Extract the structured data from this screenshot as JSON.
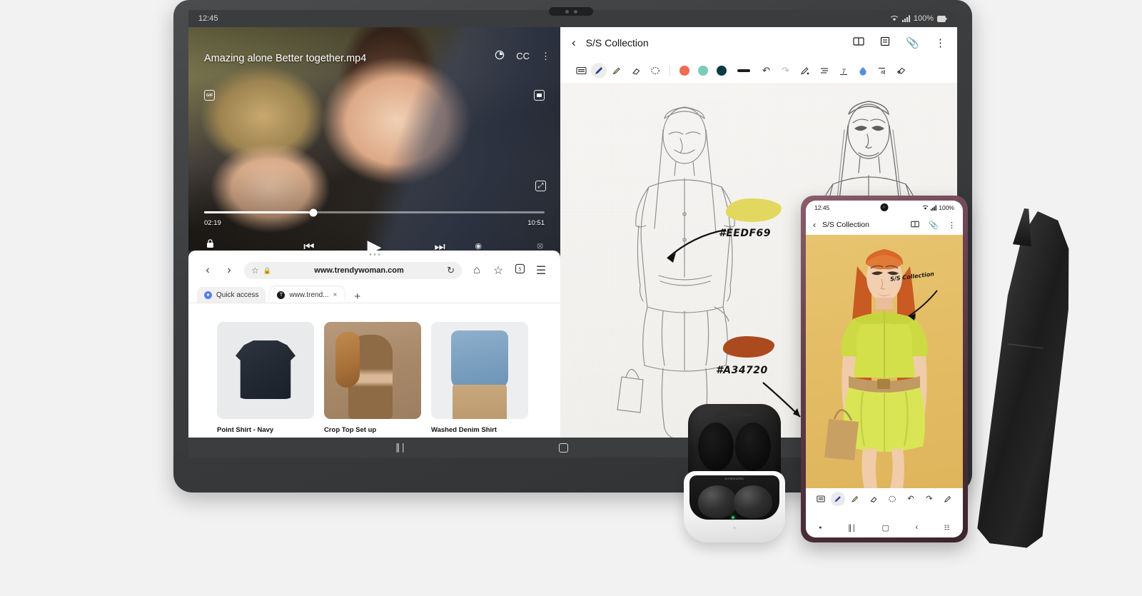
{
  "tablet": {
    "status": {
      "time": "12:45",
      "wifi_icon": "wifi-icon",
      "signal_icon": "signal-icon",
      "battery": "100%"
    },
    "video": {
      "title": "Amazing alone Better together.mp4",
      "rotate_icon": "screen-rotate-icon",
      "cc_label": "CC",
      "more_icon": "more-vertical-icon",
      "gif_chip": "GIF",
      "pip_icon": "picture-in-picture-icon",
      "expand_icon": "expand-icon",
      "current_time": "02:19",
      "total_time": "10:51",
      "progress_percent": 32,
      "lock_icon": "lock-icon",
      "prev_icon": "previous-track-icon",
      "play_icon": "play-icon",
      "next_icon": "next-track-icon"
    },
    "browser": {
      "back_icon": "chevron-left-icon",
      "forward_icon": "chevron-right-icon",
      "bookmark_icon": "star-icon",
      "lock_icon": "padlock-icon",
      "url": "www.trendywoman.com",
      "reload_icon": "reload-icon",
      "home_icon": "home-icon",
      "add_bookmark_icon": "star-add-icon",
      "tabs_count": "5",
      "menu_icon": "hamburger-menu-icon",
      "tabs": [
        {
          "label": "Quick access",
          "favicon": "quick-access-icon",
          "active": false
        },
        {
          "label": "www.trend...",
          "favicon": "site-favicon",
          "active": true
        }
      ],
      "new_tab_label": "+",
      "close_tab_label": "×",
      "products": [
        {
          "name": "Point Shirt - Navy"
        },
        {
          "name": "Crop Top Set up"
        },
        {
          "name": "Washed Denim Shirt"
        }
      ]
    },
    "notes": {
      "back_icon": "chevron-left-icon",
      "title": "S/S Collection",
      "header_icons": [
        "book-view-icon",
        "list-view-icon",
        "attachment-icon",
        "more-vertical-icon"
      ],
      "tools": [
        {
          "name": "keyboard-icon",
          "glyph": "⌨",
          "active": false
        },
        {
          "name": "pen-icon",
          "glyph": "✐",
          "active": true
        },
        {
          "name": "highlighter-icon",
          "glyph": "✒",
          "active": false
        },
        {
          "name": "eraser-icon",
          "glyph": "▱",
          "active": false
        },
        {
          "name": "lasso-select-icon",
          "glyph": "◌",
          "active": false
        }
      ],
      "colors": [
        {
          "name": "color-coral",
          "hex": "#ef6b52"
        },
        {
          "name": "color-mint",
          "hex": "#79ccb8"
        },
        {
          "name": "color-navy",
          "hex": "#0d3a45"
        }
      ],
      "pen_width_icon": "pen-width-icon",
      "edit_tools": [
        {
          "name": "undo-icon",
          "glyph": "↶"
        },
        {
          "name": "redo-icon",
          "glyph": "↷"
        },
        {
          "name": "pen-settings-icon",
          "glyph": "✒"
        },
        {
          "name": "align-icon",
          "glyph": "☰"
        },
        {
          "name": "text-convert-icon",
          "glyph": "T"
        },
        {
          "name": "shape-recognize-icon",
          "glyph": "▲"
        },
        {
          "name": "text-tool-icon",
          "glyph": "a"
        },
        {
          "name": "smart-select-icon",
          "glyph": "◇"
        }
      ],
      "annotations": [
        {
          "name": "color-swatch-yellow",
          "hex_label": "#EEDF69",
          "swatch_hex": "#e3d85f"
        },
        {
          "name": "color-swatch-brown",
          "hex_label": "#A34720",
          "swatch_hex": "#ab4a1e"
        }
      ]
    },
    "navbar": {
      "recents_icon": "recents-icon",
      "home_icon": "home-square-icon"
    }
  },
  "phone": {
    "status": {
      "time": "12:45",
      "wifi_icon": "wifi-icon",
      "signal_icon": "signal-icon",
      "battery": "100%"
    },
    "notes": {
      "back_icon": "chevron-left-icon",
      "title": "S/S Collection",
      "header_icons": [
        "book-view-icon",
        "attachment-icon",
        "more-vertical-icon"
      ],
      "sketch_annotation": "S/S Collection",
      "tools": [
        {
          "name": "keyboard-icon",
          "glyph": "⌨",
          "active": false
        },
        {
          "name": "pen-icon",
          "glyph": "✐",
          "active": true
        },
        {
          "name": "highlighter-icon",
          "glyph": "✒",
          "active": false
        },
        {
          "name": "eraser-icon",
          "glyph": "▱",
          "active": false
        },
        {
          "name": "lasso-select-icon",
          "glyph": "◌",
          "active": false
        },
        {
          "name": "undo-icon",
          "glyph": "↶",
          "active": false
        },
        {
          "name": "redo-icon",
          "glyph": "↷",
          "active": false
        },
        {
          "name": "pen-settings-icon",
          "glyph": "✒",
          "active": false
        }
      ]
    },
    "navbar": {
      "dot_icon": "dot-icon",
      "recents_icon": "recents-icon",
      "home_icon": "home-square-icon",
      "back_icon": "back-icon",
      "keyboard_icon": "keyboard-toggle-icon"
    }
  },
  "buds": {
    "brand": "SAMSUNG",
    "led": "charging-led"
  },
  "spen": {
    "name": "s-pen-stylus"
  }
}
